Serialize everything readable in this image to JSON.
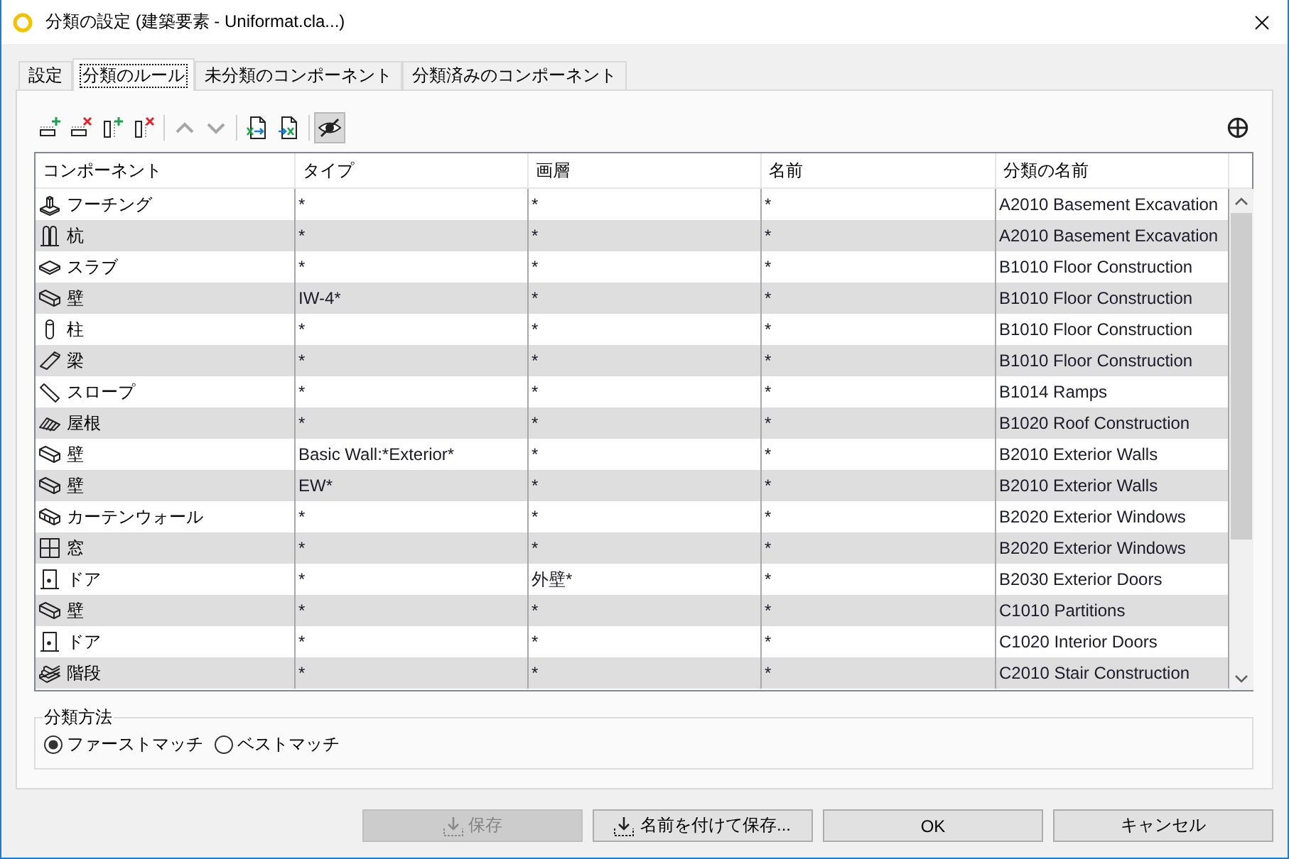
{
  "window": {
    "title": "分類の設定 (建築要素 - Uniformat.cla...)"
  },
  "tabs": [
    {
      "label": "設定",
      "selected": false
    },
    {
      "label": "分類のルール",
      "selected": true
    },
    {
      "label": "未分類のコンポーネント",
      "selected": false
    },
    {
      "label": "分類済みのコンポーネント",
      "selected": false
    }
  ],
  "toolbar": {
    "groups": [
      [
        {
          "kind": "add-row",
          "disabled": false,
          "on": false
        },
        {
          "kind": "delete-row",
          "disabled": false,
          "on": false
        },
        {
          "kind": "add-column",
          "disabled": false,
          "on": false
        },
        {
          "kind": "delete-column",
          "disabled": false,
          "on": false
        }
      ],
      [
        {
          "kind": "move-up",
          "disabled": true,
          "on": false
        },
        {
          "kind": "move-down",
          "disabled": true,
          "on": false
        }
      ],
      [
        {
          "kind": "import",
          "disabled": false,
          "on": false
        },
        {
          "kind": "export",
          "disabled": false,
          "on": false
        }
      ],
      [
        {
          "kind": "visibility",
          "disabled": false,
          "on": true
        }
      ]
    ],
    "end": [
      {
        "kind": "display-options",
        "disabled": false,
        "on": false
      }
    ]
  },
  "table": {
    "columns": [
      "コンポーネント",
      "タイプ",
      "画層",
      "名前",
      "分類の名前"
    ],
    "rows": [
      {
        "kind": "footing",
        "cells": [
          "フーチング",
          "*",
          "*",
          "*",
          "A2010 Basement Excavation"
        ]
      },
      {
        "kind": "pile",
        "cells": [
          "杭",
          "*",
          "*",
          "*",
          "A2010 Basement Excavation"
        ]
      },
      {
        "kind": "slab",
        "cells": [
          "スラブ",
          "*",
          "*",
          "*",
          "B1010 Floor Construction"
        ]
      },
      {
        "kind": "wall",
        "cells": [
          "壁",
          "IW-4*",
          "*",
          "*",
          "B1010 Floor Construction"
        ]
      },
      {
        "kind": "column",
        "cells": [
          "柱",
          "*",
          "*",
          "*",
          "B1010 Floor Construction"
        ]
      },
      {
        "kind": "beam",
        "cells": [
          "梁",
          "*",
          "*",
          "*",
          "B1010 Floor Construction"
        ]
      },
      {
        "kind": "ramp",
        "cells": [
          "スロープ",
          "*",
          "*",
          "*",
          "B1014 Ramps"
        ]
      },
      {
        "kind": "roof",
        "cells": [
          "屋根",
          "*",
          "*",
          "*",
          "B1020 Roof Construction"
        ]
      },
      {
        "kind": "wall",
        "cells": [
          "壁",
          "Basic Wall:*Exterior*",
          "*",
          "*",
          "B2010 Exterior Walls"
        ]
      },
      {
        "kind": "wall",
        "cells": [
          "壁",
          "EW*",
          "*",
          "*",
          "B2010 Exterior Walls"
        ]
      },
      {
        "kind": "curtain-wall",
        "cells": [
          "カーテンウォール",
          "*",
          "*",
          "*",
          "B2020 Exterior Windows"
        ]
      },
      {
        "kind": "window",
        "cells": [
          "窓",
          "*",
          "*",
          "*",
          "B2020 Exterior Windows"
        ]
      },
      {
        "kind": "door",
        "cells": [
          "ドア",
          "*",
          "外壁*",
          "*",
          "B2030 Exterior Doors"
        ]
      },
      {
        "kind": "wall",
        "cells": [
          "壁",
          "*",
          "*",
          "*",
          "C1010 Partitions"
        ]
      },
      {
        "kind": "door",
        "cells": [
          "ドア",
          "*",
          "*",
          "*",
          "C1020 Interior Doors"
        ]
      },
      {
        "kind": "stair",
        "cells": [
          "階段",
          "*",
          "*",
          "*",
          "C2010 Stair Construction"
        ]
      }
    ]
  },
  "classification_method": {
    "title": "分類方法",
    "options": [
      {
        "label": "ファーストマッチ",
        "selected": true
      },
      {
        "label": "ベストマッチ",
        "selected": false
      }
    ]
  },
  "buttons": [
    {
      "kind": "save",
      "label": "保存",
      "disabled": true
    },
    {
      "kind": "save",
      "label": "名前を付けて保存...",
      "disabled": false
    },
    {
      "kind": "plain",
      "label": "OK",
      "disabled": false
    },
    {
      "kind": "plain",
      "label": "キャンセル",
      "disabled": false
    }
  ]
}
